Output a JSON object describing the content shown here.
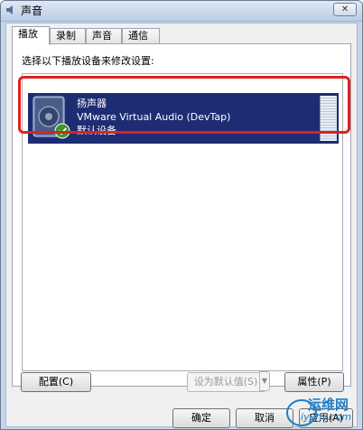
{
  "window": {
    "title": "声音",
    "close_label": "✕"
  },
  "tabs": [
    {
      "label": "播放"
    },
    {
      "label": "录制"
    },
    {
      "label": "声音"
    },
    {
      "label": "通信"
    }
  ],
  "panel": {
    "instruction": "选择以下播放设备来修改设置:",
    "devices": [
      {
        "name": "扬声器",
        "description": "VMware Virtual Audio (DevTap)",
        "status": "默认设备",
        "icon": "speaker-icon",
        "badge": "default-check-icon"
      }
    ]
  },
  "buttons": {
    "configure": "配置(C)",
    "set_default": "设为默认值(S)",
    "properties": "属性(P)",
    "ok": "确定",
    "cancel": "取消",
    "apply": "应用(A)"
  },
  "watermark": {
    "line1": "运维网",
    "line2": "iyunv.com"
  },
  "colors": {
    "selection": "#1e2c73",
    "highlight_border": "#e02020"
  }
}
